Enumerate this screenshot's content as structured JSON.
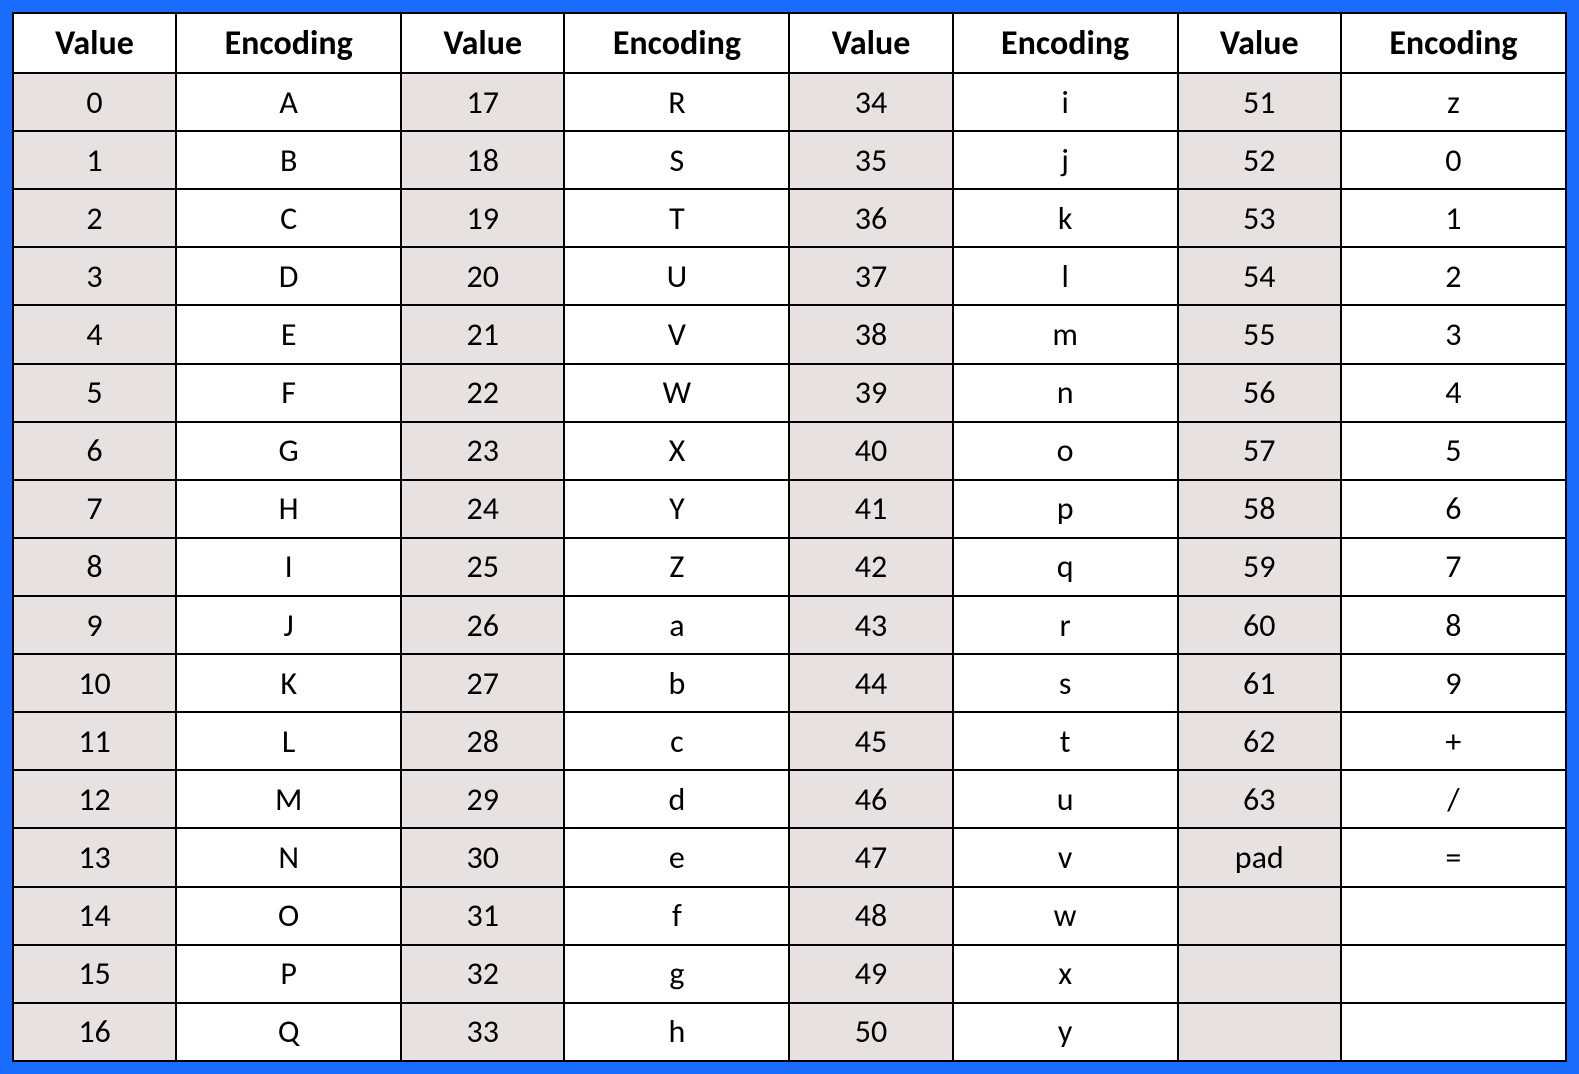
{
  "headers": {
    "value": "Value",
    "encoding": "Encoding"
  },
  "columns": [
    [
      {
        "value": "0",
        "encoding": "A"
      },
      {
        "value": "1",
        "encoding": "B"
      },
      {
        "value": "2",
        "encoding": "C"
      },
      {
        "value": "3",
        "encoding": "D"
      },
      {
        "value": "4",
        "encoding": "E"
      },
      {
        "value": "5",
        "encoding": "F"
      },
      {
        "value": "6",
        "encoding": "G"
      },
      {
        "value": "7",
        "encoding": "H"
      },
      {
        "value": "8",
        "encoding": "I"
      },
      {
        "value": "9",
        "encoding": "J"
      },
      {
        "value": "10",
        "encoding": "K"
      },
      {
        "value": "11",
        "encoding": "L"
      },
      {
        "value": "12",
        "encoding": "M"
      },
      {
        "value": "13",
        "encoding": "N"
      },
      {
        "value": "14",
        "encoding": "O"
      },
      {
        "value": "15",
        "encoding": "P"
      },
      {
        "value": "16",
        "encoding": "Q"
      }
    ],
    [
      {
        "value": "17",
        "encoding": "R"
      },
      {
        "value": "18",
        "encoding": "S"
      },
      {
        "value": "19",
        "encoding": "T"
      },
      {
        "value": "20",
        "encoding": "U"
      },
      {
        "value": "21",
        "encoding": "V"
      },
      {
        "value": "22",
        "encoding": "W"
      },
      {
        "value": "23",
        "encoding": "X"
      },
      {
        "value": "24",
        "encoding": "Y"
      },
      {
        "value": "25",
        "encoding": "Z"
      },
      {
        "value": "26",
        "encoding": "a"
      },
      {
        "value": "27",
        "encoding": "b"
      },
      {
        "value": "28",
        "encoding": "c"
      },
      {
        "value": "29",
        "encoding": "d"
      },
      {
        "value": "30",
        "encoding": "e"
      },
      {
        "value": "31",
        "encoding": "f"
      },
      {
        "value": "32",
        "encoding": "g"
      },
      {
        "value": "33",
        "encoding": "h"
      }
    ],
    [
      {
        "value": "34",
        "encoding": "i"
      },
      {
        "value": "35",
        "encoding": "j"
      },
      {
        "value": "36",
        "encoding": "k"
      },
      {
        "value": "37",
        "encoding": "l"
      },
      {
        "value": "38",
        "encoding": "m"
      },
      {
        "value": "39",
        "encoding": "n"
      },
      {
        "value": "40",
        "encoding": "o"
      },
      {
        "value": "41",
        "encoding": "p"
      },
      {
        "value": "42",
        "encoding": "q"
      },
      {
        "value": "43",
        "encoding": "r"
      },
      {
        "value": "44",
        "encoding": "s"
      },
      {
        "value": "45",
        "encoding": "t"
      },
      {
        "value": "46",
        "encoding": "u"
      },
      {
        "value": "47",
        "encoding": "v"
      },
      {
        "value": "48",
        "encoding": "w"
      },
      {
        "value": "49",
        "encoding": "x"
      },
      {
        "value": "50",
        "encoding": "y"
      }
    ],
    [
      {
        "value": "51",
        "encoding": "z"
      },
      {
        "value": "52",
        "encoding": "0"
      },
      {
        "value": "53",
        "encoding": "1"
      },
      {
        "value": "54",
        "encoding": "2"
      },
      {
        "value": "55",
        "encoding": "3"
      },
      {
        "value": "56",
        "encoding": "4"
      },
      {
        "value": "57",
        "encoding": "5"
      },
      {
        "value": "58",
        "encoding": "6"
      },
      {
        "value": "59",
        "encoding": "7"
      },
      {
        "value": "60",
        "encoding": "8"
      },
      {
        "value": "61",
        "encoding": "9"
      },
      {
        "value": "62",
        "encoding": "+"
      },
      {
        "value": "63",
        "encoding": "/"
      },
      {
        "value": "pad",
        "encoding": "="
      },
      {
        "value": "",
        "encoding": ""
      },
      {
        "value": "",
        "encoding": ""
      },
      {
        "value": "",
        "encoding": ""
      }
    ]
  ]
}
